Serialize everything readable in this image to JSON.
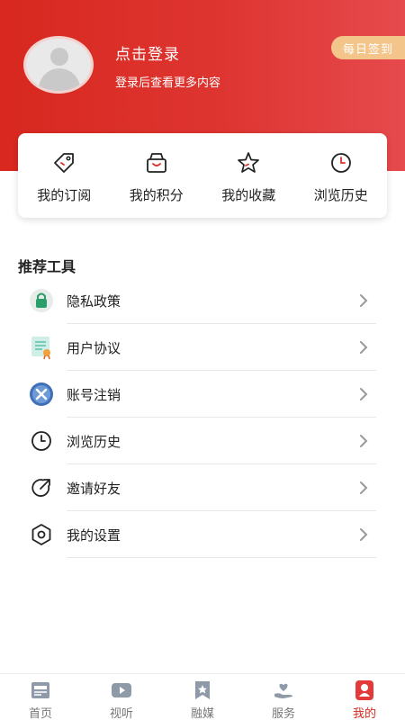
{
  "header": {
    "login_title": "点击登录",
    "login_subtitle": "登录后查看更多内容",
    "checkin_label": "每日签到"
  },
  "quick": {
    "items": [
      {
        "label": "我的订阅",
        "icon": "tag-icon"
      },
      {
        "label": "我的积分",
        "icon": "bag-icon"
      },
      {
        "label": "我的收藏",
        "icon": "star-icon"
      },
      {
        "label": "浏览历史",
        "icon": "clock-icon"
      }
    ]
  },
  "tools": {
    "title": "推荐工具",
    "items": [
      {
        "label": "隐私政策",
        "icon": "lock-icon"
      },
      {
        "label": "用户协议",
        "icon": "document-icon"
      },
      {
        "label": "账号注销",
        "icon": "cancel-icon"
      },
      {
        "label": "浏览历史",
        "icon": "clock-icon"
      },
      {
        "label": "邀请好友",
        "icon": "share-icon"
      },
      {
        "label": "我的设置",
        "icon": "settings-icon"
      }
    ]
  },
  "tabbar": {
    "items": [
      {
        "label": "首页",
        "icon": "newspaper-icon",
        "active": false
      },
      {
        "label": "视听",
        "icon": "video-icon",
        "active": false
      },
      {
        "label": "融媒",
        "icon": "bookmark-star-icon",
        "active": false
      },
      {
        "label": "服务",
        "icon": "heart-hand-icon",
        "active": false
      },
      {
        "label": "我的",
        "icon": "user-icon",
        "active": true
      }
    ]
  },
  "colors": {
    "brand_red": "#d8281f",
    "checkin_bg": "#f4c58b"
  }
}
